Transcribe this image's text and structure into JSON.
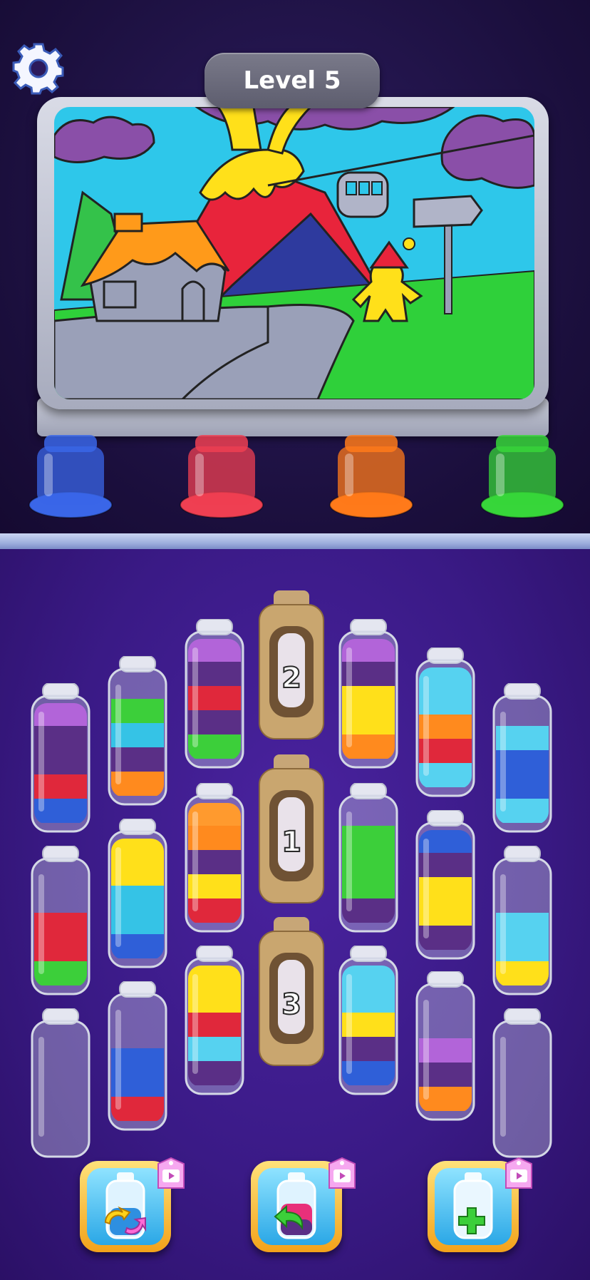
{
  "header": {
    "level_label": "Level 5"
  },
  "icons": {
    "settings": "gear-icon"
  },
  "sand_jars": [
    {
      "color": "#3a66e8",
      "name": "blue"
    },
    {
      "color": "#ef3f52",
      "name": "red"
    },
    {
      "color": "#ff7a1a",
      "name": "orange"
    },
    {
      "color": "#37d63a",
      "name": "green"
    }
  ],
  "mystery_bottles": [
    {
      "number": "2"
    },
    {
      "number": "1"
    },
    {
      "number": "3"
    }
  ],
  "bottles": [
    {
      "layers_top_to_bottom": [
        "#b264d9",
        "#5a2f86",
        "#5a2f86",
        "#e0283b",
        "#2f5fd8"
      ]
    },
    {
      "layers_top_to_bottom": [
        "#3ccf3a",
        "#35c3e6",
        "#5a2f86",
        "#ff8a1e"
      ]
    },
    {
      "layers_top_to_bottom": [
        "#b264d9",
        "#5a2f86",
        "#e0283b",
        "#5a2f86",
        "#3ccf3a"
      ]
    },
    {
      "layers_top_to_bottom": [
        "#b264d9",
        "#5a2f86",
        "#ffe01a",
        "#ffe01a",
        "#ff8a1e"
      ]
    },
    {
      "layers_top_to_bottom": [
        "#56d2f0",
        "#56d2f0",
        "#ff8a1e",
        "#e0283b",
        "#56d2f0"
      ]
    },
    {
      "layers_top_to_bottom": [
        "#56d2f0",
        "#2f5fd8",
        "#2f5fd8",
        "#56d2f0"
      ]
    },
    {
      "layers_top_to_bottom": [
        "#ff9a2e",
        "#ff8a1e",
        "#5a2f86",
        "#ffe01a",
        "#e0283b"
      ]
    },
    {
      "layers_top_to_bottom": [
        "#ffe01a",
        "#ffe01a",
        "#35c3e6",
        "#35c3e6",
        "#2f5fd8"
      ]
    },
    {
      "layers_top_to_bottom": [
        "#3ccf3a",
        "#3ccf3a",
        "#3ccf3a",
        "#5a2f86"
      ]
    },
    {
      "layers_top_to_bottom": [
        "#2f5fd8",
        "#5a2f86",
        "#ffe01a",
        "#ffe01a",
        "#5a2f86"
      ]
    },
    {
      "layers_top_to_bottom": [
        "#e0283b",
        "#e0283b",
        "#3ccf3a"
      ]
    },
    {
      "layers_top_to_bottom": [
        "#56d2f0",
        "#56d2f0",
        "#ffe01a"
      ]
    },
    {
      "layers_top_to_bottom": [
        "#ffe01a",
        "#ffe01a",
        "#e0283b",
        "#56d2f0",
        "#5a2f86"
      ]
    },
    {
      "layers_top_to_bottom": [
        "#56d2f0",
        "#56d2f0",
        "#ffe01a",
        "#5a2f86",
        "#2f5fd8"
      ]
    },
    {
      "layers_top_to_bottom": [
        "#2f5fd8",
        "#2f5fd8",
        "#e0283b"
      ]
    },
    {
      "layers_top_to_bottom": [
        "#b264d9",
        "#5a2f86",
        "#ff8a1e"
      ]
    },
    {
      "layers_top_to_bottom": []
    },
    {
      "layers_top_to_bottom": []
    }
  ],
  "boosters": [
    {
      "name": "shuffle-booster",
      "icon": "bottle-shuffle-icon",
      "badge": "video-ad-icon"
    },
    {
      "name": "undo-booster",
      "icon": "bottle-undo-icon",
      "badge": "video-ad-icon"
    },
    {
      "name": "add-bottle-booster",
      "icon": "bottle-add-icon",
      "badge": "video-ad-icon"
    }
  ]
}
